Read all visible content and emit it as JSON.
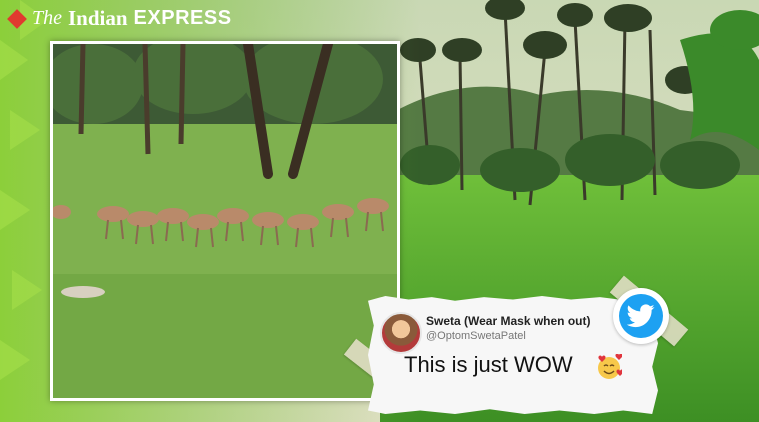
{
  "logo": {
    "the": "The",
    "indian": "Indian",
    "express": "EXPRESS",
    "brand_color": "#e03a2f"
  },
  "tweet": {
    "display_name": "Sweta (Wear Mask when out)",
    "handle": "@OptomSwetaPatel",
    "text": "This is just WOW",
    "emoji_icon": "smiling-face-with-hearts-icon",
    "bird_icon": "twitter-bird-icon",
    "accent_color": "#1da1f2"
  }
}
